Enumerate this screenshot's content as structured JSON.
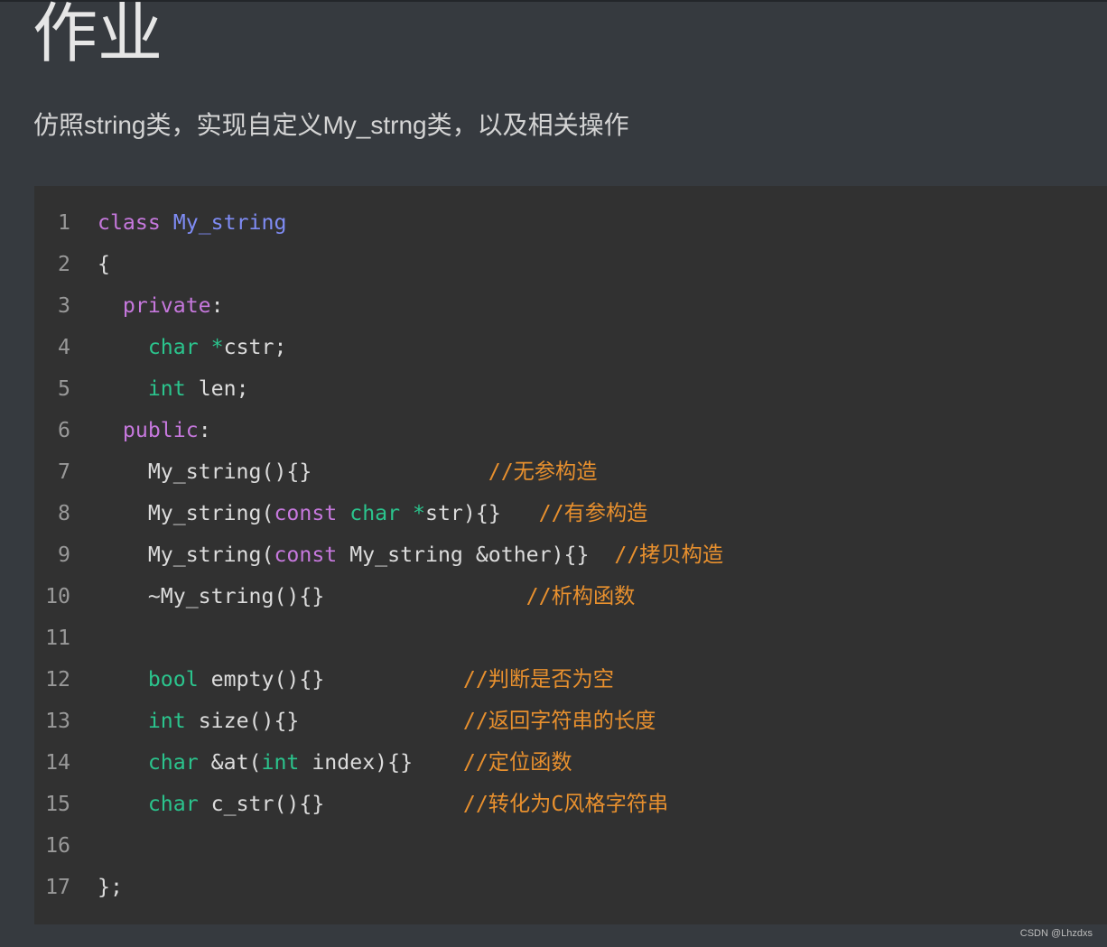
{
  "title": "作业",
  "description": "仿照string类，实现自定义My_strng类，以及相关操作",
  "code_lines": [
    {
      "n": "1",
      "tokens": [
        {
          "t": "class",
          "c": "kw"
        },
        {
          "t": " ",
          "c": "pl"
        },
        {
          "t": "My_string",
          "c": "fn"
        }
      ]
    },
    {
      "n": "2",
      "tokens": [
        {
          "t": "{",
          "c": "pl"
        }
      ]
    },
    {
      "n": "3",
      "tokens": [
        {
          "t": "  ",
          "c": "pl"
        },
        {
          "t": "private",
          "c": "kw"
        },
        {
          "t": ":",
          "c": "pl"
        }
      ]
    },
    {
      "n": "4",
      "tokens": [
        {
          "t": "    ",
          "c": "pl"
        },
        {
          "t": "char",
          "c": "ty"
        },
        {
          "t": " ",
          "c": "pl"
        },
        {
          "t": "*",
          "c": "ty"
        },
        {
          "t": "cstr;",
          "c": "pl"
        }
      ]
    },
    {
      "n": "5",
      "tokens": [
        {
          "t": "    ",
          "c": "pl"
        },
        {
          "t": "int",
          "c": "ty"
        },
        {
          "t": " len;",
          "c": "pl"
        }
      ]
    },
    {
      "n": "6",
      "tokens": [
        {
          "t": "  ",
          "c": "pl"
        },
        {
          "t": "public",
          "c": "kw"
        },
        {
          "t": ":",
          "c": "pl"
        }
      ]
    },
    {
      "n": "7",
      "tokens": [
        {
          "t": "    My_string(){}              ",
          "c": "pl"
        },
        {
          "t": "//无参构造",
          "c": "cm"
        }
      ]
    },
    {
      "n": "8",
      "tokens": [
        {
          "t": "    My_string(",
          "c": "pl"
        },
        {
          "t": "const",
          "c": "kw"
        },
        {
          "t": " ",
          "c": "pl"
        },
        {
          "t": "char",
          "c": "ty"
        },
        {
          "t": " ",
          "c": "pl"
        },
        {
          "t": "*",
          "c": "ty"
        },
        {
          "t": "str){}   ",
          "c": "pl"
        },
        {
          "t": "//有参构造",
          "c": "cm"
        }
      ]
    },
    {
      "n": "9",
      "tokens": [
        {
          "t": "    My_string(",
          "c": "pl"
        },
        {
          "t": "const",
          "c": "kw"
        },
        {
          "t": " My_string &other){}  ",
          "c": "pl"
        },
        {
          "t": "//拷贝构造",
          "c": "cm"
        }
      ]
    },
    {
      "n": "10",
      "tokens": [
        {
          "t": "    ~My_string(){}                ",
          "c": "pl"
        },
        {
          "t": "//析构函数",
          "c": "cm"
        }
      ]
    },
    {
      "n": "11",
      "tokens": []
    },
    {
      "n": "12",
      "tokens": [
        {
          "t": "    ",
          "c": "pl"
        },
        {
          "t": "bool",
          "c": "ty"
        },
        {
          "t": " empty(){}           ",
          "c": "pl"
        },
        {
          "t": "//判断是否为空",
          "c": "cm"
        }
      ]
    },
    {
      "n": "13",
      "tokens": [
        {
          "t": "    ",
          "c": "pl"
        },
        {
          "t": "int",
          "c": "ty"
        },
        {
          "t": " size(){}             ",
          "c": "pl"
        },
        {
          "t": "//返回字符串的长度",
          "c": "cm"
        }
      ]
    },
    {
      "n": "14",
      "tokens": [
        {
          "t": "    ",
          "c": "pl"
        },
        {
          "t": "char",
          "c": "ty"
        },
        {
          "t": " &at(",
          "c": "pl"
        },
        {
          "t": "int",
          "c": "ty"
        },
        {
          "t": " index){}    ",
          "c": "pl"
        },
        {
          "t": "//定位函数",
          "c": "cm"
        }
      ]
    },
    {
      "n": "15",
      "tokens": [
        {
          "t": "    ",
          "c": "pl"
        },
        {
          "t": "char",
          "c": "ty"
        },
        {
          "t": " c_str(){}           ",
          "c": "pl"
        },
        {
          "t": "//转化为C风格字符串",
          "c": "cm"
        }
      ]
    },
    {
      "n": "16",
      "tokens": []
    },
    {
      "n": "17",
      "tokens": [
        {
          "t": "};",
          "c": "pl"
        }
      ]
    }
  ],
  "watermark": "CSDN @Lhzdxs",
  "colors": {
    "background": "#363a3f",
    "code_background": "#313131",
    "keyword": "#c678dd",
    "type": "#2bc48d",
    "function_name": "#7f8cf5",
    "comment": "#e8902e",
    "plain": "#dcdcdc",
    "line_number": "#999999"
  }
}
